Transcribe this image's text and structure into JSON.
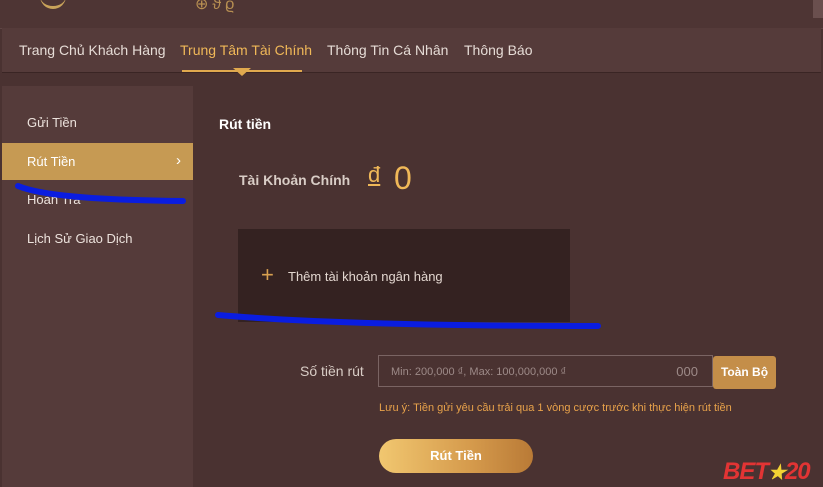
{
  "nav": {
    "items": [
      {
        "label": "Trang Chủ Khách Hàng",
        "active": false
      },
      {
        "label": "Trung Tâm Tài Chính",
        "active": true
      },
      {
        "label": "Thông Tin Cá Nhân",
        "active": false
      },
      {
        "label": "Thông Báo",
        "active": false
      }
    ]
  },
  "sidebar": {
    "items": [
      {
        "label": "Gửi Tiền",
        "active": false
      },
      {
        "label": "Rút Tiền",
        "active": true,
        "chevron": "›"
      },
      {
        "label": "Hoàn Trả",
        "active": false
      },
      {
        "label": "Lịch Sử Giao Dịch",
        "active": false
      }
    ]
  },
  "main": {
    "title": "Rút tiền",
    "balance": {
      "label": "Tài Khoản Chính",
      "currency": "đ",
      "value": "0"
    },
    "bank_card": {
      "icon": "plus-icon",
      "label": "Thêm tài khoản ngân hàng"
    },
    "amount": {
      "label": "Số tiền rút",
      "placeholder": "Min: 200,000 ₫, Max: 100,000,000 ₫",
      "value": "",
      "suffix": "000"
    },
    "all_button": "Toàn Bộ",
    "note": "Lưu ý: Tiền gửi yêu cầu trải qua 1 vòng cược trước khi thực hiện rút tiền",
    "submit_button": "Rút Tiền"
  },
  "watermark": {
    "left": "BET",
    "star": "★",
    "right": "20"
  },
  "colors": {
    "accent": "#f0b858",
    "active_sidebar": "#c69a53",
    "background": "#4a3231",
    "panel": "#553b3a",
    "scribble": "#0a1de0",
    "note": "#e8a24a"
  }
}
